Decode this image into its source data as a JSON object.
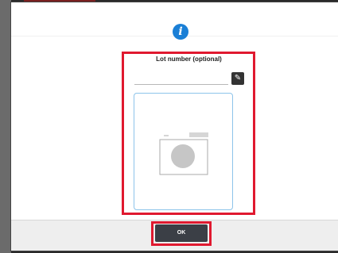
{
  "dialog": {
    "info_icon": "info-icon",
    "info_glyph": "i",
    "lot_label": "Lot number (optional)",
    "lot_value": "",
    "edit_icon": "pencil-icon",
    "edit_glyph": "✎",
    "side_text": "",
    "camera_icon": "camera-icon",
    "ok_label": "OK"
  },
  "colors": {
    "accent": "#1a7fd6",
    "highlight": "#e0192f",
    "ok_button": "#3b3f46",
    "photo_border": "#8dc4ea"
  }
}
